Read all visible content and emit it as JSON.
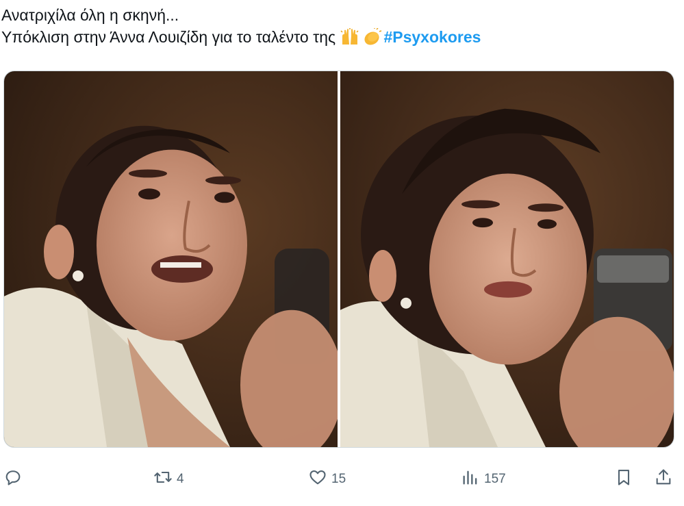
{
  "tweet": {
    "line1": "Ανατριχίλα όλη η σκηνή...",
    "line2_text": "Υπόκλιση στην Άννα Λουιζίδη για το ταλέντο της ",
    "emojis": [
      "raising-hands-emoji",
      "clapping-hands-emoji"
    ],
    "hashtag": "#Psyxokores"
  },
  "media": {
    "photos": [
      {
        "description_name": "photo-left"
      },
      {
        "description_name": "photo-right"
      }
    ]
  },
  "actions": {
    "reply": {
      "icon": "reply-icon",
      "count": ""
    },
    "retweet": {
      "icon": "retweet-icon",
      "count": "4"
    },
    "like": {
      "icon": "heart-icon",
      "count": "15"
    },
    "views": {
      "icon": "views-icon",
      "count": "157"
    },
    "bookmark": {
      "icon": "bookmark-icon"
    },
    "share": {
      "icon": "share-icon"
    }
  },
  "colors": {
    "text": "#0f1419",
    "secondary": "#536471",
    "accent": "#1d9bf0"
  }
}
